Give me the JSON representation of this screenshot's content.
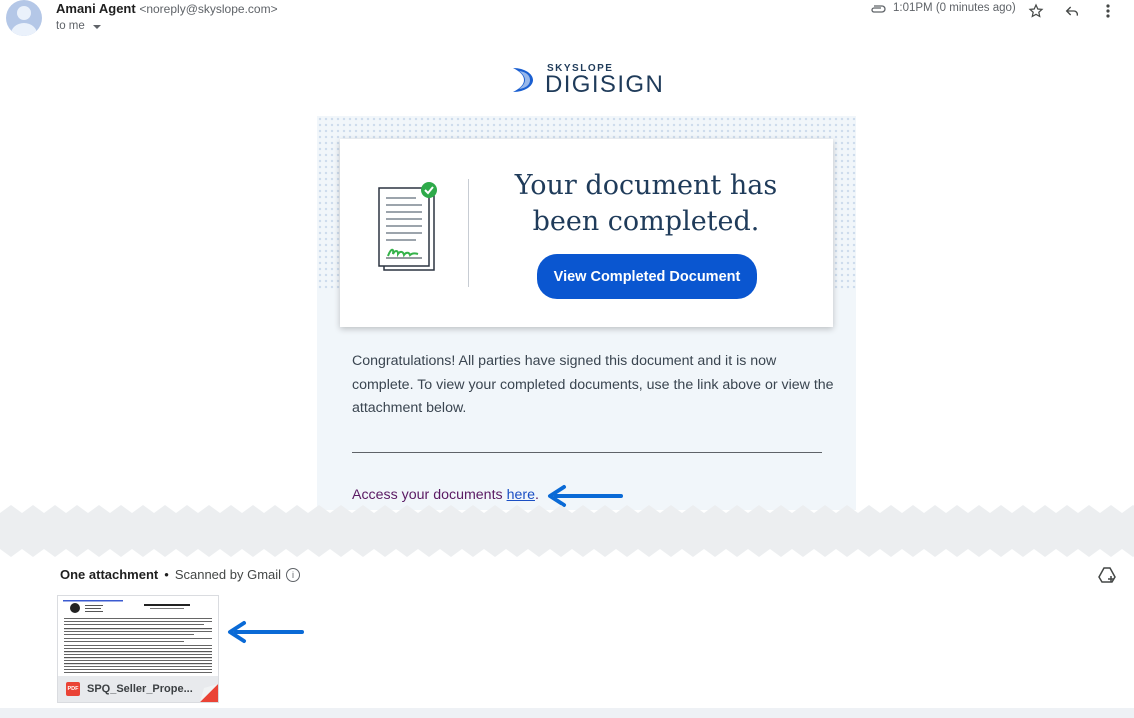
{
  "header": {
    "sender_name": "Amani Agent",
    "sender_email": "<noreply@skyslope.com>",
    "recipient": "to me",
    "time": "1:01PM (0 minutes ago)"
  },
  "logo": {
    "top": "SKYSLOPE",
    "main": "DIGISIGN"
  },
  "email": {
    "headline": "Your document has been completed.",
    "button_label": "View Completed Document",
    "congrats": "Congratulations! All parties have signed this document and it is now complete. To view your completed documents, use the link above or view the attachment below.",
    "access_text": "Access your documents ",
    "access_link": "here",
    "access_end": "."
  },
  "attachments": {
    "title": "One attachment",
    "separator": "•",
    "scanned": "Scanned by Gmail",
    "info_glyph": "i",
    "file": {
      "badge": "PDF",
      "name": "SPQ_Seller_Prope..."
    }
  },
  "colors": {
    "button": "#0a56d0",
    "arrow": "#0a6ad6",
    "headline": "#1f3b5a"
  }
}
